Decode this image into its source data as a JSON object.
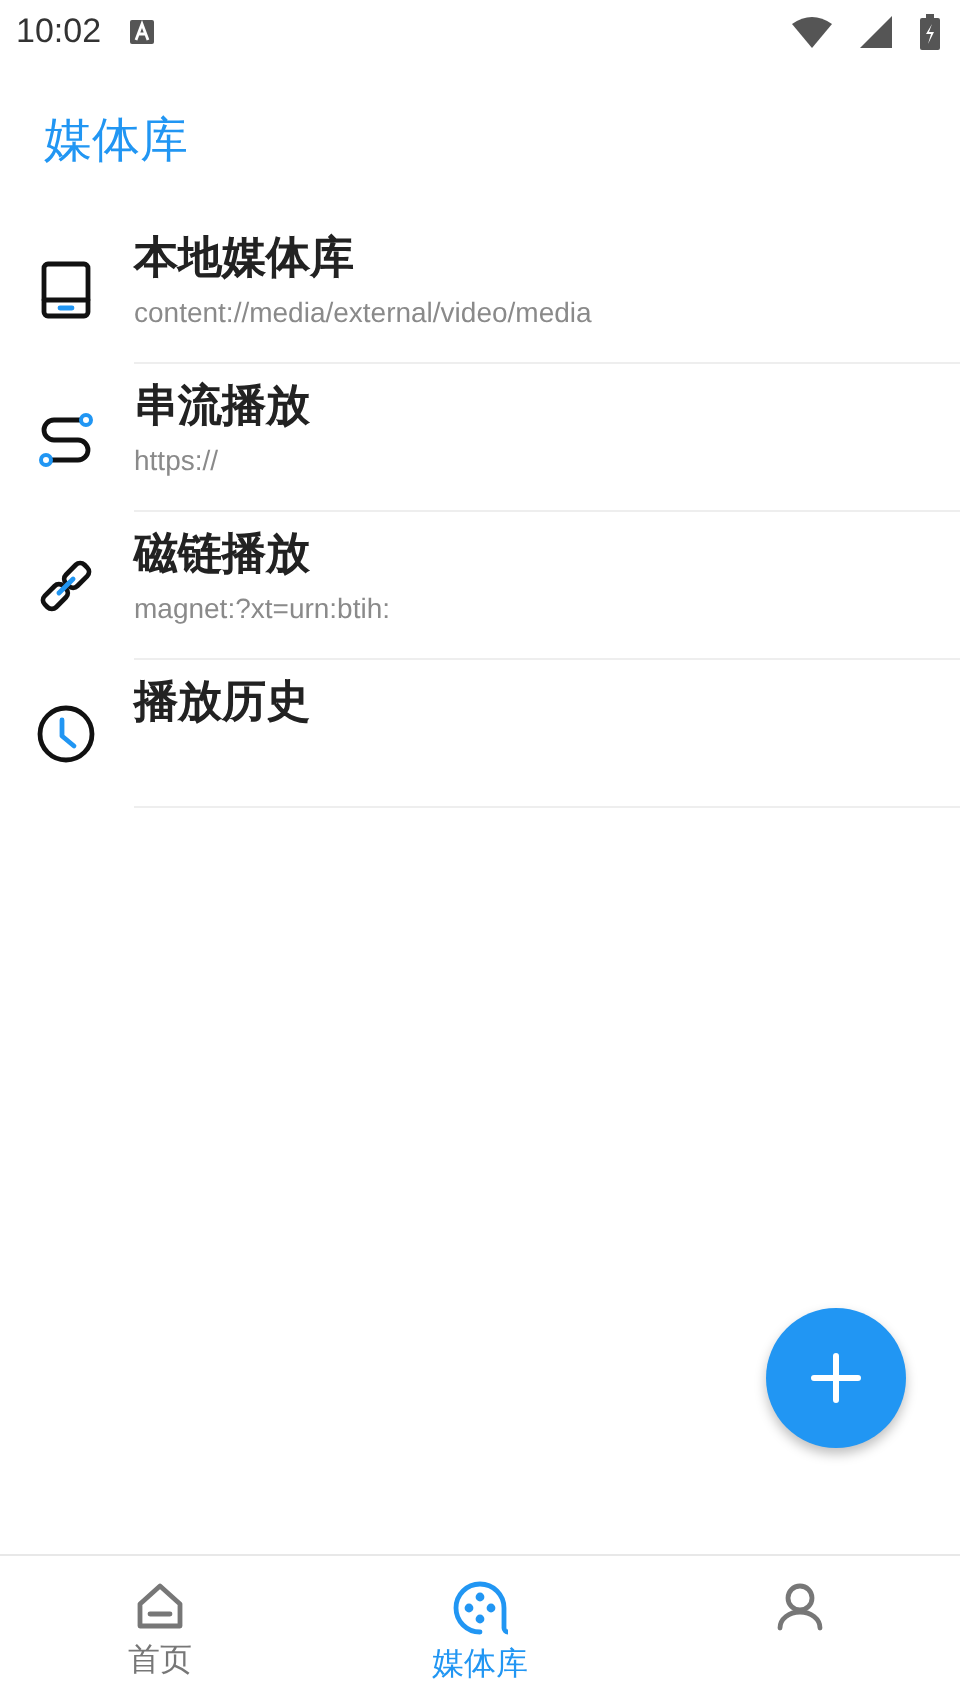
{
  "status_bar": {
    "time": "10:02"
  },
  "app_bar": {
    "title": "媒体库"
  },
  "items": [
    {
      "kind": "local",
      "title": "本地媒体库",
      "subtitle": "content://media/external/video/media"
    },
    {
      "kind": "stream",
      "title": "串流播放",
      "subtitle": "https://"
    },
    {
      "kind": "magnet",
      "title": "磁链播放",
      "subtitle": "magnet:?xt=urn:btih:"
    },
    {
      "kind": "history",
      "title": "播放历史"
    }
  ],
  "fab": {
    "kind": "add"
  },
  "bottom_nav": [
    {
      "kind": "home",
      "label": "首页",
      "selected": false
    },
    {
      "kind": "library",
      "label": "媒体库",
      "selected": true
    },
    {
      "kind": "profile",
      "selected": false
    }
  ]
}
